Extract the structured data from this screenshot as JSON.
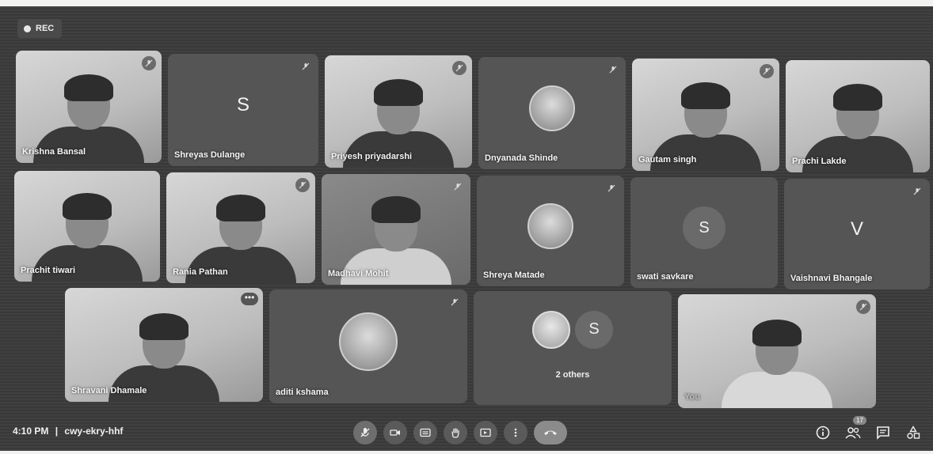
{
  "meeting": {
    "rec_label": "REC",
    "time": "4:10 PM",
    "separator": "|",
    "code": "cwy-ekry-hhf",
    "people_badge": "17"
  },
  "tiles": {
    "t1": "Krishna Bansal",
    "t2": "Shreyas Dulange",
    "t2_letter": "S",
    "t3": "Priyesh priyadarshi",
    "t4": "Dnyanada Shinde",
    "t5": "Gautam singh",
    "t6": "Prachi Lakde",
    "t7": "Prachit tiwari",
    "t8": "Rania Pathan",
    "t9": "Madhavi Mohit",
    "t10": "Shreya Matade",
    "t11": "swati savkare",
    "t11_letter": "S",
    "t12": "Vaishnavi Bhangale",
    "t12_letter": "V",
    "t13": "Shravani Dhamale",
    "t14": "aditi kshama",
    "t15_others": "2 others",
    "t15_letter": "S",
    "t16": "You"
  },
  "icons": [
    "rec-dot",
    "mic-off-icon",
    "more-options-icon",
    "camera-icon",
    "captions-icon",
    "raise-hand-icon",
    "present-icon",
    "more-vert-icon",
    "end-call-icon",
    "info-icon",
    "people-icon",
    "chat-icon",
    "activities-icon"
  ]
}
